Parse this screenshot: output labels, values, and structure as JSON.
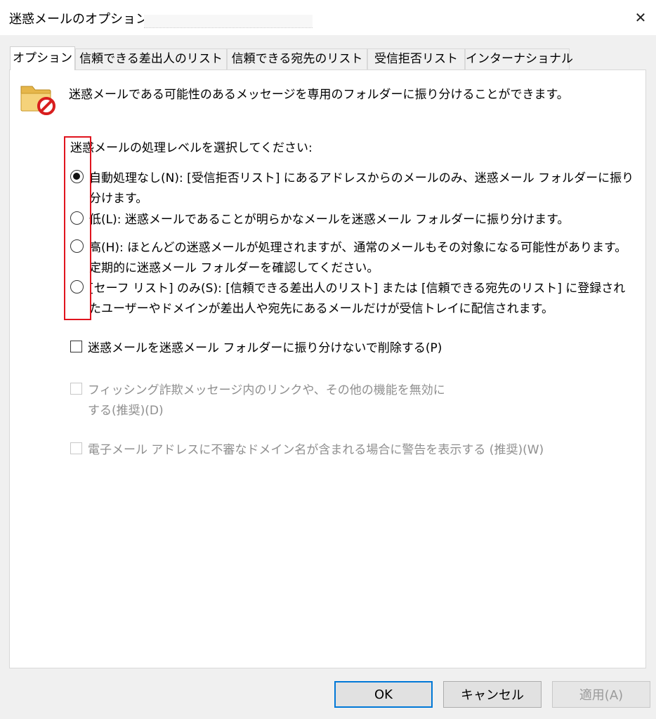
{
  "window": {
    "title": "迷惑メールのオプション -",
    "close_label": "✕"
  },
  "tabs": [
    {
      "label": "オプション",
      "active": true
    },
    {
      "label": "信頼できる差出人のリスト",
      "active": false
    },
    {
      "label": "信頼できる宛先のリスト",
      "active": false
    },
    {
      "label": "受信拒否リスト",
      "active": false
    },
    {
      "label": "インターナショナル",
      "active": false
    }
  ],
  "options": {
    "intro": "迷惑メールである可能性のあるメッセージを専用のフォルダーに振り分けることができます。",
    "level_heading": "迷惑メールの処理レベルを選択してください:",
    "levels": [
      {
        "label": "自動処理なし(N): [受信拒否リスト] にあるアドレスからのメールのみ、迷惑メール フォルダーに振り分けます。",
        "checked": true
      },
      {
        "label": "低(L): 迷惑メールであることが明らかなメールを迷惑メール フォルダーに振り分けます。",
        "checked": false
      },
      {
        "label": "高(H): ほとんどの迷惑メールが処理されますが、通常のメールもその対象になる可能性があります。定期的に迷惑メール フォルダーを確認してください。",
        "checked": false
      },
      {
        "label": "[セーフ リスト] のみ(S): [信頼できる差出人のリスト] または [信頼できる宛先のリスト] に登録されたユーザーやドメインが差出人や宛先にあるメールだけが受信トレイに配信されます。",
        "checked": false
      }
    ],
    "checkboxes": [
      {
        "label": "迷惑メールを迷惑メール フォルダーに振り分けないで削除する(P)",
        "checked": false,
        "enabled": true
      },
      {
        "label": "フィッシング詐欺メッセージ内のリンクや、その他の機能を無効にする(推奨)(D)",
        "checked": false,
        "enabled": false
      },
      {
        "label": "電子メール アドレスに不審なドメイン名が含まれる場合に警告を表示する (推奨)(W)",
        "checked": false,
        "enabled": false
      }
    ]
  },
  "buttons": {
    "ok": "OK",
    "cancel": "キャンセル",
    "apply": "適用(A)"
  },
  "colors": {
    "highlight_box": "#e0141e",
    "default_button_border": "#0078d7",
    "disabled_text": "#8f8f8f"
  },
  "icons": {
    "header": "junk-folder-blocked-icon",
    "close": "close-icon"
  }
}
